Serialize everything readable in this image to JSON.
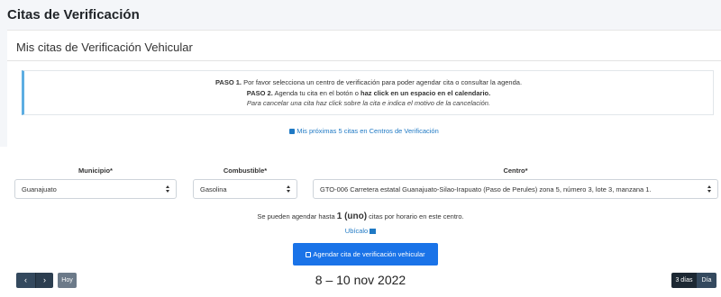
{
  "header": {
    "title": "Citas de Verificación"
  },
  "card": {
    "title": "Mis citas de Verificación Vehicular",
    "info": {
      "step1_bold": "PASO 1.",
      "step1_text": " Por favor selecciona un centro de verificación para poder agendar cita o consultar la agenda.",
      "step2_bold": "PASO 2.",
      "step2_text": " Agenda tu cita en el botón o ",
      "step2_bold2": "haz click en un espacio en el calendario.",
      "cancel_text": "Para cancelar una cita haz click sobre la cita e indica el motivo de la cancelación."
    },
    "next_link": "Mis próximas 5 citas en Centros de Verificación"
  },
  "form": {
    "municipio": {
      "label": "Municipio*",
      "value": "Guanajuato"
    },
    "combustible": {
      "label": "Combustible*",
      "value": "Gasolina"
    },
    "centro": {
      "label": "Centro*",
      "value": "GTO-006 Carretera estatal Guanajuato-Silao-Irapuato (Paso de Perules) zona 5, número 3, lote 3, manzana 1."
    },
    "capacity_pre": "Se pueden agendar hasta ",
    "capacity_num": "1 (uno)",
    "capacity_post": " citas por horario en este centro.",
    "locate_link": "Ubícalo",
    "schedule_button": "Agendar cita de verificación vehicular"
  },
  "calendar": {
    "prev_icon": "‹",
    "next_icon": "›",
    "today": "Hoy",
    "range": "8 – 10 nov 2022",
    "views": [
      "3 días",
      "Día"
    ]
  }
}
